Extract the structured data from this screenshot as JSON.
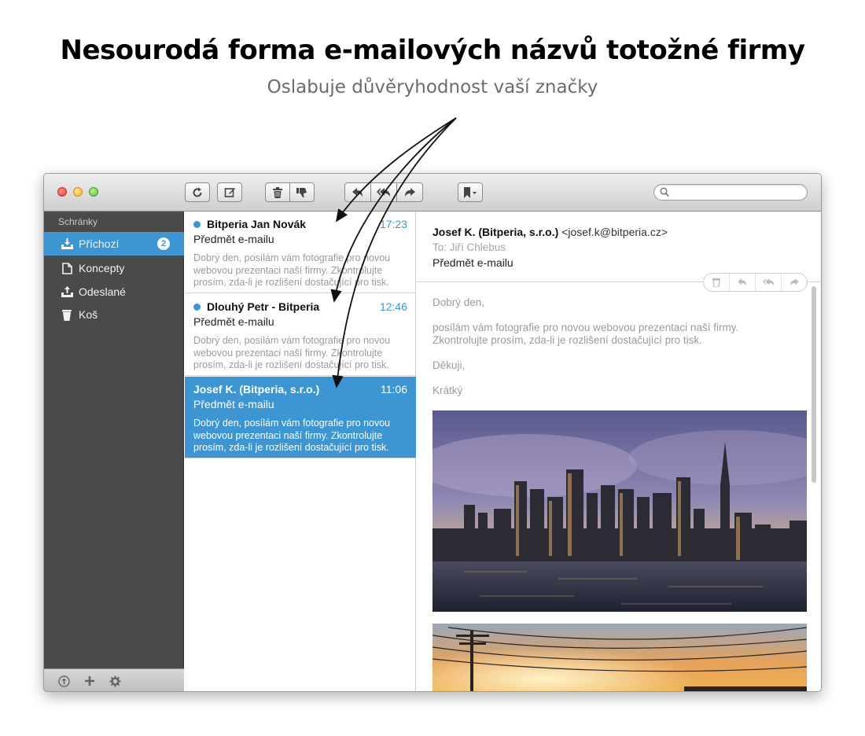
{
  "headline": "Nesourodá forma e-mailových názvů totožné firmy",
  "subheadline": "Oslabuje důvěryhodnost vaší značky",
  "toolbar": {
    "buttons": [
      "refresh-icon",
      "compose-icon",
      "trash-icon",
      "junk-icon",
      "reply-icon",
      "reply-all-icon",
      "forward-icon",
      "flag-icon"
    ],
    "search_placeholder": ""
  },
  "sidebar": {
    "heading": "Schránky",
    "items": [
      {
        "label": "Příchozí",
        "icon": "inbox-icon",
        "badge": "2",
        "active": true
      },
      {
        "label": "Koncepty",
        "icon": "document-icon"
      },
      {
        "label": "Odeslané",
        "icon": "sent-icon"
      },
      {
        "label": "Koš",
        "icon": "trash-icon"
      }
    ],
    "footer_icons": [
      "upload-icon",
      "plus-icon",
      "gear-icon"
    ]
  },
  "messages": [
    {
      "sender": "Bitperia Jan Novák",
      "time": "17:23",
      "subject": "Předmět e-mailu",
      "preview": "Dobrý den, posílám vám fotografie pro novou webovou prezentaci naší firmy. Zkontrolujte prosím, zda-li je rozlišení dostačující pro tisk.",
      "unread": true
    },
    {
      "sender": "Dlouhý Petr - Bitperia",
      "time": "12:46",
      "subject": "Předmět e-mailu",
      "preview": "Dobrý den, posílám vám fotografie pro novou webovou prezentaci naší firmy. Zkontrolujte prosím, zda-li je rozlišení dostačující pro tisk.",
      "unread": true
    },
    {
      "sender": "Josef K. (Bitperia, s.r.o.)",
      "time": "11:06",
      "subject": "Předmět e-mailu",
      "preview": "Dobrý den, posílám vám fotografie pro novou webovou prezentaci naší firmy. Zkontrolujte prosím, zda-li je rozlišení dostačující pro tisk.",
      "selected": true
    }
  ],
  "reading": {
    "from_name": "Josef K. (Bitperia, s.r.o.)",
    "from_addr": "<josef.k@bitperia.cz>",
    "to": "To: Jiří Chlebus",
    "subject": "Předmět e-mailu",
    "greeting": "Dobrý den,",
    "body": "posílám vám fotografie pro novou webovou prezentaci naší firmy. Zkontrolujte prosím, zda-li je rozlišení dostačující pro tisk.",
    "thanks": "Děkuji,",
    "signature": "Krátký",
    "attachments": [
      "city-skyline-photo",
      "sunset-power-lines-photo"
    ]
  },
  "colors": {
    "accent": "#3d95d2",
    "sidebar": "#4a4a4a"
  }
}
